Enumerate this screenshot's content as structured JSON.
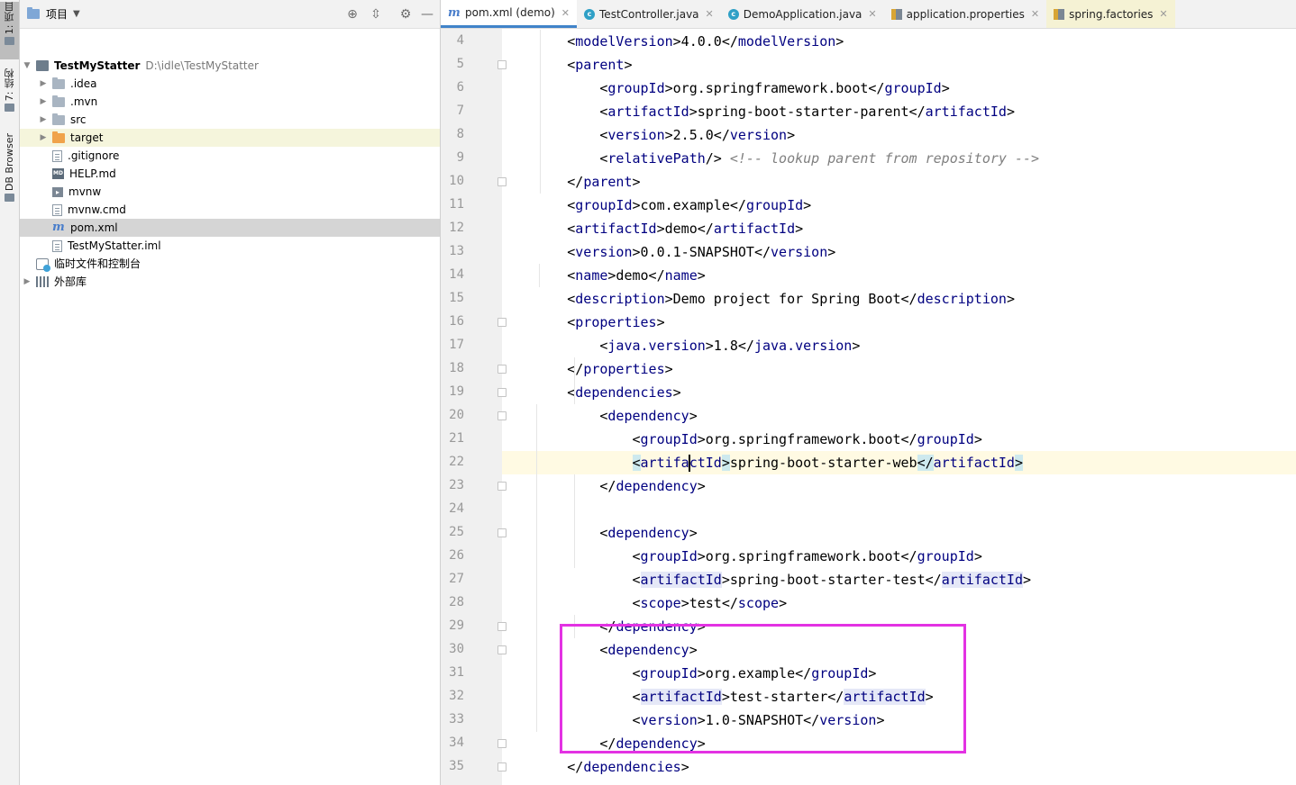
{
  "left_strip": {
    "project_label": "1: 项目",
    "structure_label": "7: 结构",
    "db_label": "DB Browser"
  },
  "project_panel": {
    "title": "项目",
    "tree": [
      {
        "label": "TestMyStatter",
        "path": "D:\\idle\\TestMyStatter",
        "icon": "module-icon",
        "indent": 0,
        "arrow": "▼"
      },
      {
        "label": ".idea",
        "icon": "folder-icon",
        "indent": 1,
        "arrow": "▶"
      },
      {
        "label": ".mvn",
        "icon": "folder-icon",
        "indent": 1,
        "arrow": "▶"
      },
      {
        "label": "src",
        "icon": "folder-icon",
        "indent": 1,
        "arrow": "▶"
      },
      {
        "label": "target",
        "icon": "orange-folder-icon",
        "indent": 1,
        "arrow": "▶"
      },
      {
        "label": ".gitignore",
        "icon": "file-icon",
        "indent": 1,
        "arrow": ""
      },
      {
        "label": "HELP.md",
        "icon": "markdown-icon",
        "indent": 1,
        "arrow": ""
      },
      {
        "label": "mvnw",
        "icon": "terminal-icon",
        "indent": 1,
        "arrow": ""
      },
      {
        "label": "mvnw.cmd",
        "icon": "file-icon",
        "indent": 1,
        "arrow": ""
      },
      {
        "label": "pom.xml",
        "icon": "maven-icon",
        "indent": 1,
        "arrow": ""
      },
      {
        "label": "TestMyStatter.iml",
        "icon": "file-icon",
        "indent": 1,
        "arrow": ""
      },
      {
        "label": "临时文件和控制台",
        "icon": "scratches-icon",
        "indent": 0,
        "arrow": ""
      },
      {
        "label": "外部库",
        "icon": "library-icon",
        "indent": 0,
        "arrow": "▶"
      }
    ]
  },
  "tabs": [
    {
      "label": "pom.xml (demo)",
      "icon": "maven-icon"
    },
    {
      "label": "TestController.java",
      "icon": "class-icon"
    },
    {
      "label": "DemoApplication.java",
      "icon": "class-icon"
    },
    {
      "label": "application.properties",
      "icon": "properties-icon"
    },
    {
      "label": "spring.factories",
      "icon": "properties-icon"
    }
  ],
  "editor": {
    "first_line": 4,
    "current_line": 22,
    "lines": [
      [
        [
          "b",
          "<"
        ],
        [
          "t",
          "modelVersion"
        ],
        [
          "b",
          ">4.0.0</"
        ],
        [
          "t",
          "modelVersion"
        ],
        [
          "b",
          ">"
        ]
      ],
      [
        [
          "b",
          "<"
        ],
        [
          "t",
          "parent"
        ],
        [
          "b",
          ">"
        ]
      ],
      [
        [
          "b",
          "<"
        ],
        [
          "t",
          "groupId"
        ],
        [
          "b",
          ">org.springframework.boot</"
        ],
        [
          "t",
          "groupId"
        ],
        [
          "b",
          ">"
        ]
      ],
      [
        [
          "b",
          "<"
        ],
        [
          "t",
          "artifactId"
        ],
        [
          "b",
          ">spring-boot-starter-parent</"
        ],
        [
          "t",
          "artifactId"
        ],
        [
          "b",
          ">"
        ]
      ],
      [
        [
          "b",
          "<"
        ],
        [
          "t",
          "version"
        ],
        [
          "b",
          ">2.5.0</"
        ],
        [
          "t",
          "version"
        ],
        [
          "b",
          ">"
        ]
      ],
      [
        [
          "b",
          "<"
        ],
        [
          "t",
          "relativePath"
        ],
        [
          "b",
          "/> "
        ],
        [
          "c",
          "<!-- lookup parent from repository -->"
        ]
      ],
      [
        [
          "b",
          "</"
        ],
        [
          "t",
          "parent"
        ],
        [
          "b",
          ">"
        ]
      ],
      [
        [
          "b",
          "<"
        ],
        [
          "t",
          "groupId"
        ],
        [
          "b",
          ">com.example</"
        ],
        [
          "t",
          "groupId"
        ],
        [
          "b",
          ">"
        ]
      ],
      [
        [
          "b",
          "<"
        ],
        [
          "t",
          "artifactId"
        ],
        [
          "b",
          ">demo</"
        ],
        [
          "t",
          "artifactId"
        ],
        [
          "b",
          ">"
        ]
      ],
      [
        [
          "b",
          "<"
        ],
        [
          "t",
          "version"
        ],
        [
          "b",
          ">0.0.1-SNAPSHOT</"
        ],
        [
          "t",
          "version"
        ],
        [
          "b",
          ">"
        ]
      ],
      [
        [
          "b",
          "<"
        ],
        [
          "t",
          "name"
        ],
        [
          "b",
          ">demo</"
        ],
        [
          "t",
          "name"
        ],
        [
          "b",
          ">"
        ]
      ],
      [
        [
          "b",
          "<"
        ],
        [
          "t",
          "description"
        ],
        [
          "b",
          ">Demo project for Spring Boot</"
        ],
        [
          "t",
          "description"
        ],
        [
          "b",
          ">"
        ]
      ],
      [
        [
          "b",
          "<"
        ],
        [
          "t",
          "properties"
        ],
        [
          "b",
          ">"
        ]
      ],
      [
        [
          "b",
          "<"
        ],
        [
          "t",
          "java.version"
        ],
        [
          "b",
          ">1.8</"
        ],
        [
          "t",
          "java.version"
        ],
        [
          "b",
          ">"
        ]
      ],
      [
        [
          "b",
          "</"
        ],
        [
          "t",
          "properties"
        ],
        [
          "b",
          ">"
        ]
      ],
      [
        [
          "b",
          "<"
        ],
        [
          "t",
          "dependencies"
        ],
        [
          "b",
          ">"
        ]
      ],
      [
        [
          "b",
          "<"
        ],
        [
          "t",
          "dependency"
        ],
        [
          "b",
          ">"
        ]
      ],
      [
        [
          "b",
          "<"
        ],
        [
          "t",
          "groupId"
        ],
        [
          "b",
          ">org.springframework.boot</"
        ],
        [
          "t",
          "groupId"
        ],
        [
          "b",
          ">"
        ]
      ],
      [
        [
          "m",
          "<"
        ],
        [
          "t",
          "artifactId"
        ],
        [
          "m",
          ">"
        ],
        [
          "b",
          "spring-boot-starter-web"
        ],
        [
          "m",
          "</"
        ],
        [
          "t",
          "artifactId"
        ],
        [
          "m",
          ">"
        ]
      ],
      [
        [
          "b",
          "</"
        ],
        [
          "t",
          "dependency"
        ],
        [
          "b",
          ">"
        ]
      ],
      [],
      [
        [
          "b",
          "<"
        ],
        [
          "t",
          "dependency"
        ],
        [
          "b",
          ">"
        ]
      ],
      [
        [
          "b",
          "<"
        ],
        [
          "t",
          "groupId"
        ],
        [
          "b",
          ">org.springframework.boot</"
        ],
        [
          "t",
          "groupId"
        ],
        [
          "b",
          ">"
        ]
      ],
      [
        [
          "b",
          "<"
        ],
        [
          "h",
          "artifactId"
        ],
        [
          "b",
          ">spring-boot-starter-test</"
        ],
        [
          "h",
          "artifactId"
        ],
        [
          "b",
          ">"
        ]
      ],
      [
        [
          "b",
          "<"
        ],
        [
          "t",
          "scope"
        ],
        [
          "b",
          ">test</"
        ],
        [
          "t",
          "scope"
        ],
        [
          "b",
          ">"
        ]
      ],
      [
        [
          "b",
          "</"
        ],
        [
          "t",
          "dependency"
        ],
        [
          "b",
          ">"
        ]
      ],
      [
        [
          "b",
          "<"
        ],
        [
          "t",
          "dependency"
        ],
        [
          "b",
          ">"
        ]
      ],
      [
        [
          "b",
          "<"
        ],
        [
          "t",
          "groupId"
        ],
        [
          "b",
          ">org.example</"
        ],
        [
          "t",
          "groupId"
        ],
        [
          "b",
          ">"
        ]
      ],
      [
        [
          "b",
          "<"
        ],
        [
          "h",
          "artifactId"
        ],
        [
          "b",
          ">test-starter</"
        ],
        [
          "h",
          "artifactId"
        ],
        [
          "b",
          ">"
        ]
      ],
      [
        [
          "b",
          "<"
        ],
        [
          "t",
          "version"
        ],
        [
          "b",
          ">1.0-SNAPSHOT</"
        ],
        [
          "t",
          "version"
        ],
        [
          "b",
          ">"
        ]
      ],
      [
        [
          "b",
          "</"
        ],
        [
          "t",
          "dependency"
        ],
        [
          "b",
          ">"
        ]
      ],
      [
        [
          "b",
          "</"
        ],
        [
          "t",
          "dependencies"
        ],
        [
          "b",
          ">"
        ]
      ]
    ]
  },
  "colors": {
    "tag": "#000080",
    "comment": "#808080",
    "annotation_box": "#e332e3",
    "active_tab_underline": "#4083c9"
  }
}
